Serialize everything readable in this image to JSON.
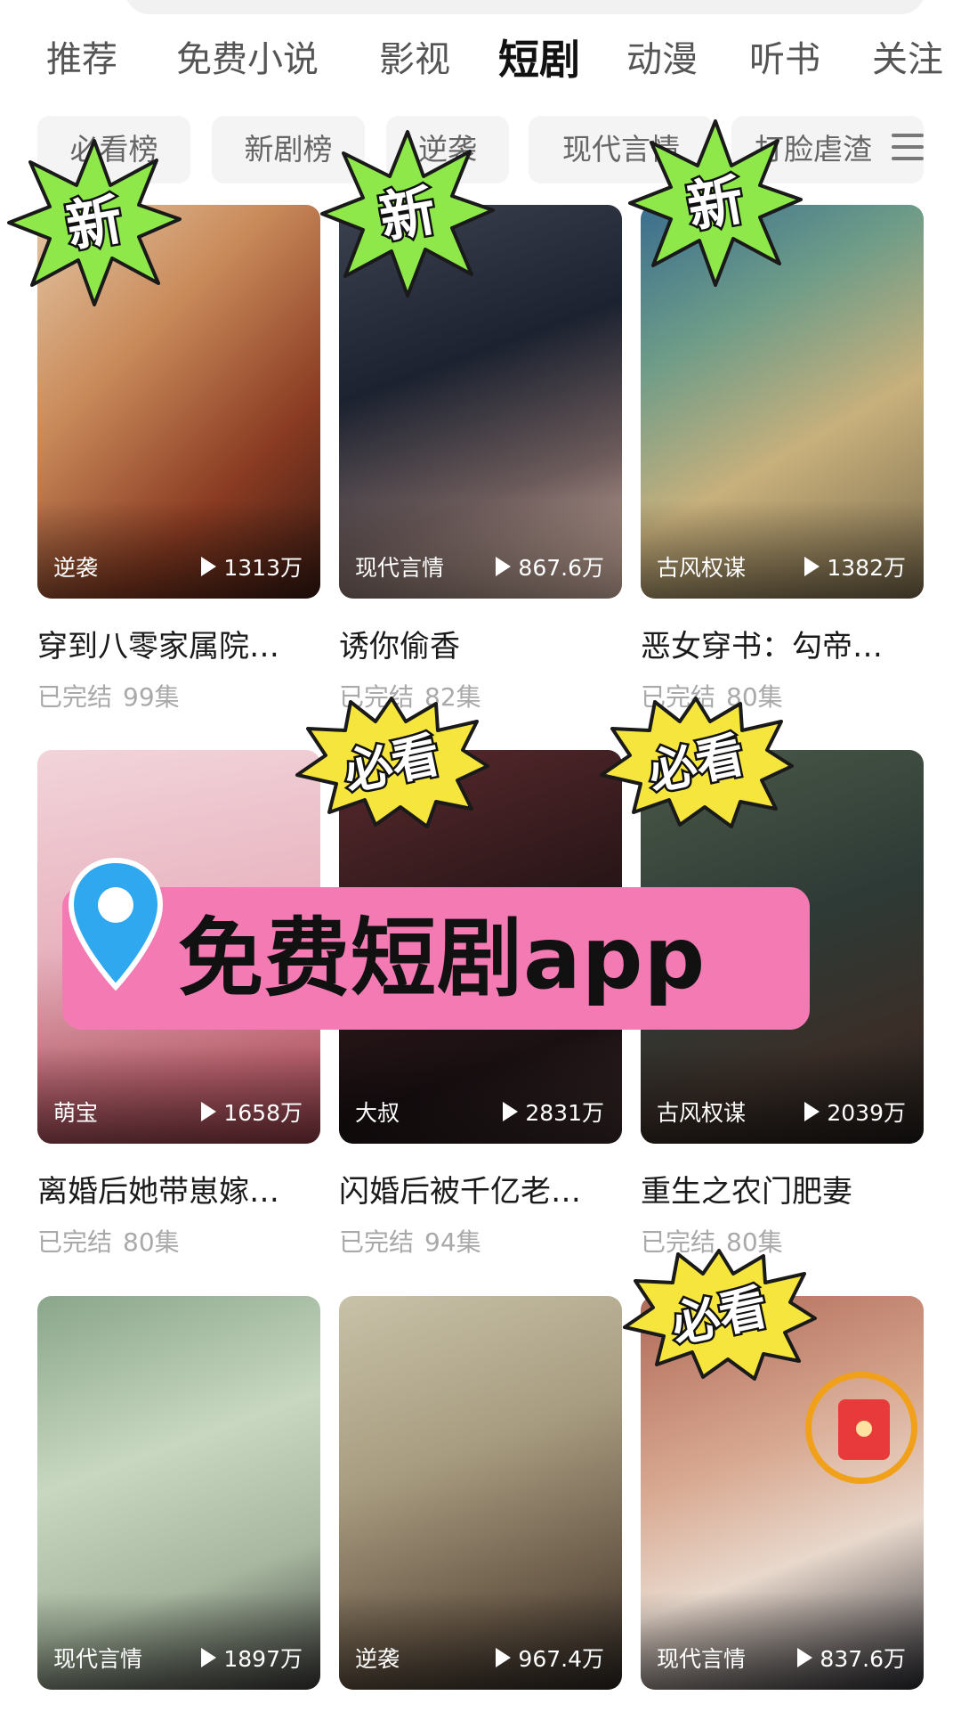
{
  "nav": {
    "tabs": [
      "推荐",
      "免费小说",
      "影视",
      "短剧",
      "动漫",
      "听书",
      "关注"
    ],
    "active": "短剧"
  },
  "chips": [
    "必看榜",
    "新剧榜",
    "逆袭",
    "现代言情",
    "打脸虐渣"
  ],
  "badges": {
    "new": "新",
    "must_watch": "必看"
  },
  "promo": {
    "text": "免费短剧app"
  },
  "dramas": [
    {
      "title": "穿到八零家属院…",
      "genre": "逆袭",
      "views": "1313万",
      "status": "已完结",
      "episodes": "99集",
      "badge": "new"
    },
    {
      "title": "诱你偷香",
      "genre": "现代言情",
      "views": "867.6万",
      "status": "已完结",
      "episodes": "82集",
      "badge": "new"
    },
    {
      "title": "恶女穿书：勾帝…",
      "genre": "古风权谋",
      "views": "1382万",
      "status": "已完结",
      "episodes": "80集",
      "badge": "new"
    },
    {
      "title": "离婚后她带崽嫁…",
      "genre": "萌宝",
      "views": "1658万",
      "status": "已完结",
      "episodes": "80集",
      "badge": ""
    },
    {
      "title": "闪婚后被千亿老…",
      "genre": "大叔",
      "views": "2831万",
      "status": "已完结",
      "episodes": "94集",
      "badge": "must"
    },
    {
      "title": "重生之农门肥妻",
      "genre": "古风权谋",
      "views": "2039万",
      "status": "已完结",
      "episodes": "80集",
      "badge": "must"
    },
    {
      "title": "",
      "genre": "现代言情",
      "views": "1897万",
      "status": "",
      "episodes": "",
      "badge": ""
    },
    {
      "title": "",
      "genre": "逆袭",
      "views": "967.4万",
      "status": "",
      "episodes": "",
      "badge": ""
    },
    {
      "title": "",
      "genre": "现代言情",
      "views": "837.6万",
      "status": "",
      "episodes": "",
      "badge": "must"
    }
  ],
  "colors": {
    "new_badge": "#8fe84a",
    "must_badge": "#f6e53c",
    "promo_bg": "#f47ab3",
    "pin": "#2fa8f0"
  }
}
